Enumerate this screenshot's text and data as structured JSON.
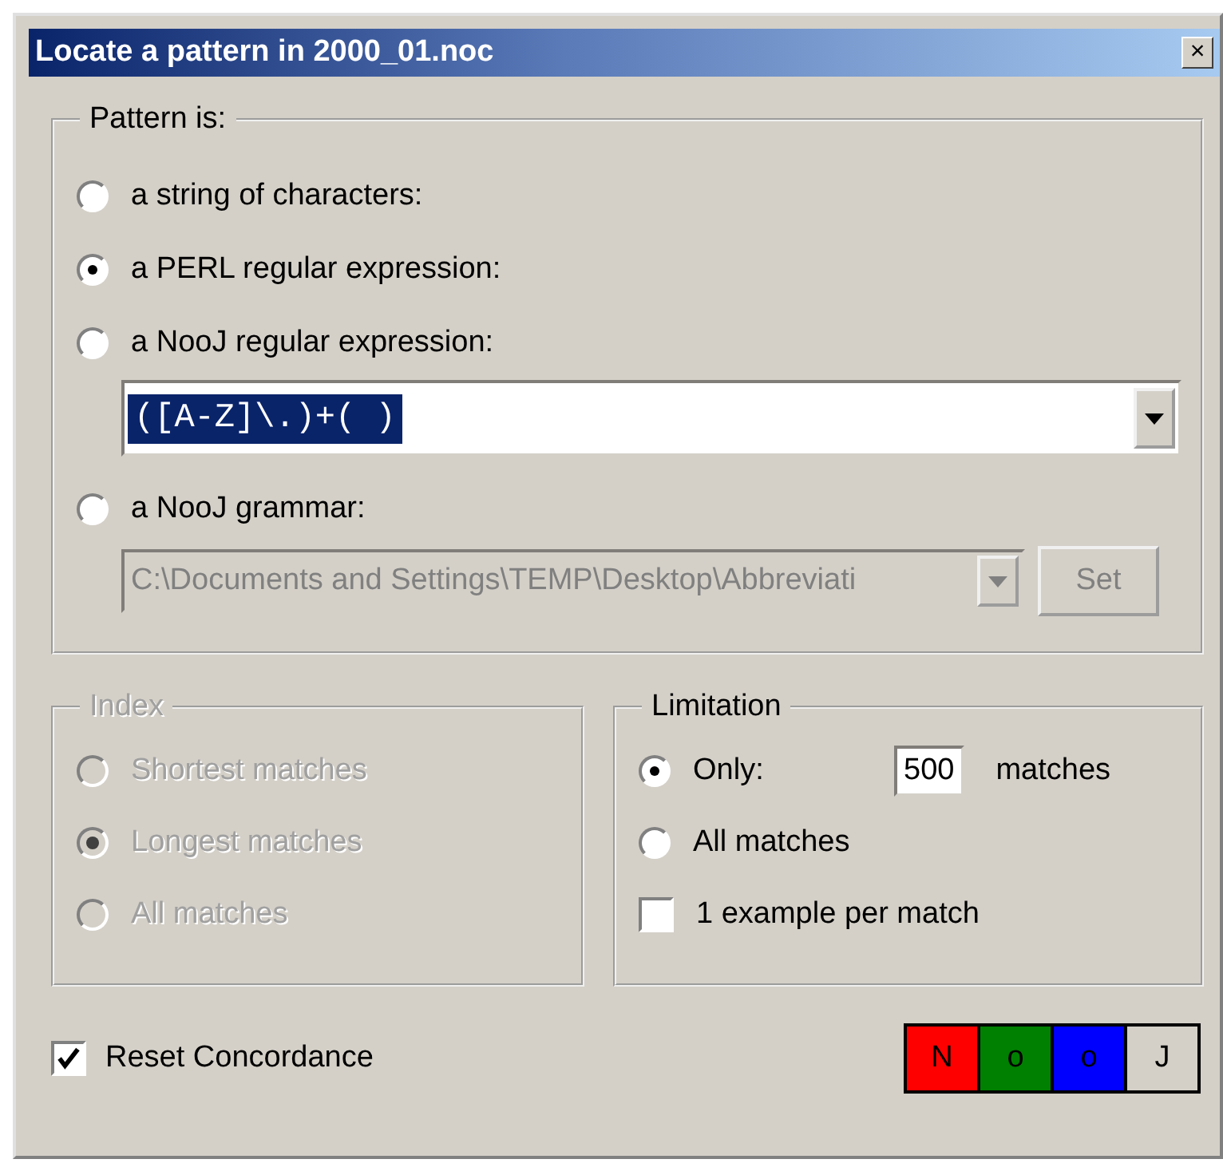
{
  "window": {
    "title": "Locate a pattern in 2000_01.noc",
    "close": "×"
  },
  "pattern": {
    "legend": "Pattern is:",
    "options": [
      {
        "kind": "plain",
        "label": "a string of characters:",
        "selected": false
      },
      {
        "kind": "plain",
        "label": "a PERL regular expression:",
        "selected": true
      },
      {
        "kind": "combo",
        "label": "a NooJ regular expression:",
        "selected": false,
        "value": "([A-Z]\\.)+( )",
        "disabled": false
      },
      {
        "kind": "file",
        "label": "a NooJ grammar:",
        "selected": false,
        "value": "C:\\Documents and Settings\\TEMP\\Desktop\\Abbreviati",
        "disabled": true,
        "button": "Set"
      }
    ]
  },
  "index": {
    "legend": "Index",
    "disabled": true,
    "options": [
      {
        "label": "Shortest matches",
        "selected": false
      },
      {
        "label": "Longest matches",
        "selected": true
      },
      {
        "label": "All matches",
        "selected": false
      }
    ]
  },
  "limitation": {
    "legend": "Limitation",
    "options": [
      {
        "kind": "count",
        "label": "Only:",
        "value": "500",
        "suffix": "matches",
        "selected": true
      },
      {
        "kind": "plain",
        "label": "All matches",
        "selected": false
      }
    ],
    "example": {
      "label": "1 example per match",
      "checked": false
    }
  },
  "reset": {
    "label": "Reset Concordance",
    "checked": true
  },
  "logo": [
    {
      "letter": "N",
      "color": "#ff0000"
    },
    {
      "letter": "o",
      "color": "#008000"
    },
    {
      "letter": "o",
      "color": "#0000ff"
    },
    {
      "letter": "J",
      "color": "#d4d0c8"
    }
  ]
}
